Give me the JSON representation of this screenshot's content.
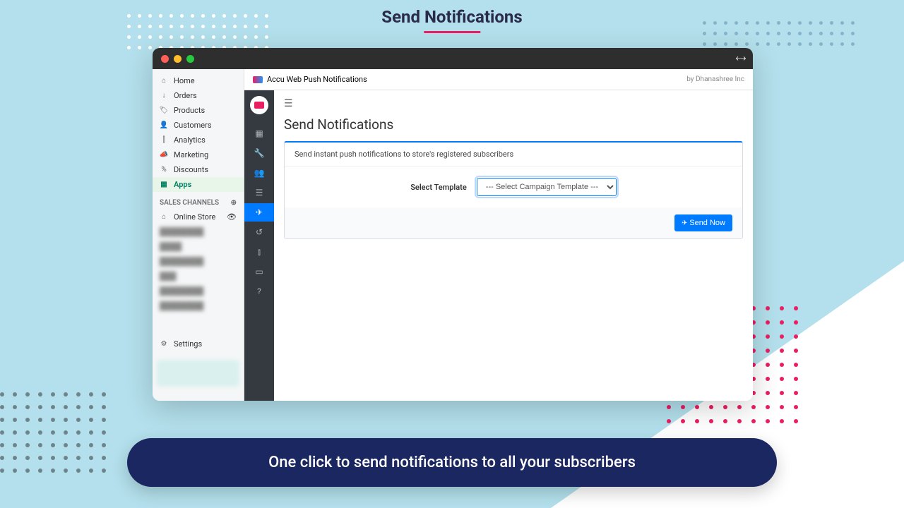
{
  "header": {
    "title": "Send Notifications"
  },
  "tagline": "One click to send notifications to all your subscribers",
  "shopifyNav": {
    "items": [
      {
        "label": "Home",
        "icon": "⌂"
      },
      {
        "label": "Orders",
        "icon": "↓"
      },
      {
        "label": "Products",
        "icon": "🏷"
      },
      {
        "label": "Customers",
        "icon": "👤"
      },
      {
        "label": "Analytics",
        "icon": "⫿"
      },
      {
        "label": "Marketing",
        "icon": "📣"
      },
      {
        "label": "Discounts",
        "icon": "%"
      },
      {
        "label": "Apps",
        "icon": "▦",
        "active": true
      }
    ],
    "salesChannelsLabel": "SALES CHANNELS",
    "onlineStore": "Online Store",
    "settings": "Settings"
  },
  "app": {
    "title": "Accu Web Push Notifications",
    "by": "by Dhanashree Inc",
    "page": {
      "heading": "Send Notifications",
      "description": "Send instant push notifications to store's registered subscribers",
      "selectLabel": "Select Template",
      "selectPlaceholder": "--- Select Campaign Template ---",
      "sendButton": "Send Now"
    },
    "sideIcons": [
      "▦",
      "🔧",
      "👥",
      "☰",
      "✈",
      "↺",
      "⫾",
      "▭",
      "?"
    ]
  }
}
